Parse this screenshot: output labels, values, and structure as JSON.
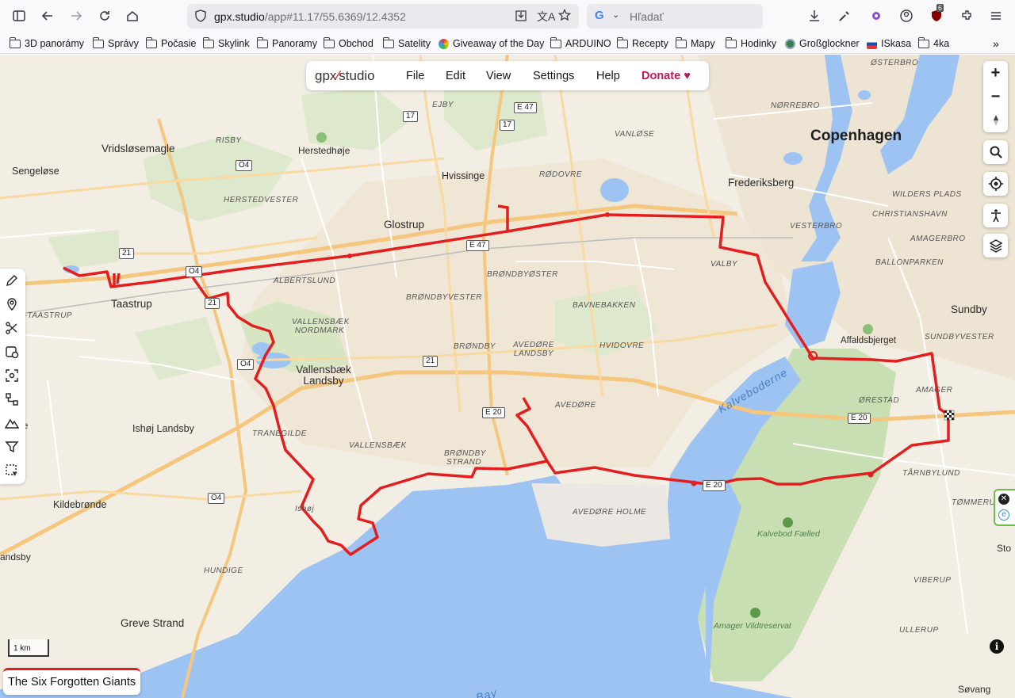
{
  "browser": {
    "url_host": "gpx.studio",
    "url_path": "/app#11.17/55.6369/12.4352",
    "search_placeholder": "Hľadať",
    "ext_badge": "6"
  },
  "bookmarks": [
    {
      "label": "3D panorámy",
      "icon": "folder-icon"
    },
    {
      "label": "Správy",
      "icon": "folder-icon"
    },
    {
      "label": "Počasie",
      "icon": "folder-icon"
    },
    {
      "label": "Skylink",
      "icon": "folder-icon"
    },
    {
      "label": "Panoramy",
      "icon": "folder-icon"
    },
    {
      "label": "Obchod",
      "icon": "folder-icon"
    },
    {
      "label": "Satelity",
      "icon": "folder-icon"
    },
    {
      "label": "Giveaway of the Day",
      "icon": "giveaway-icon"
    },
    {
      "label": "ARDUINO",
      "icon": "folder-icon"
    },
    {
      "label": "Recepty",
      "icon": "folder-icon"
    },
    {
      "label": "Mapy",
      "icon": "folder-icon"
    },
    {
      "label": "Hodinky",
      "icon": "folder-icon"
    },
    {
      "label": "Großglockner",
      "icon": "globe-icon"
    },
    {
      "label": "ISkasa",
      "icon": "flag-icon"
    },
    {
      "label": "4ka",
      "icon": "folder-icon"
    }
  ],
  "app": {
    "logo_left": "gpx",
    "logo_right": "studio",
    "menu": [
      "File",
      "Edit",
      "View",
      "Settings",
      "Help"
    ],
    "donate": "Donate",
    "track_name": "The Six Forgotten Giants",
    "scale": "1 km",
    "zoom_in": "+",
    "zoom_out": "−"
  },
  "map_labels": {
    "big": [
      "Copenhagen"
    ],
    "cities": [
      "Vridsløsemagle",
      "Sengeløse",
      "Herstedhøje",
      "Hvissinge",
      "Glostrup",
      "Frederiksberg",
      "Taastrup",
      "Vallensbæk Landsby",
      "Ishøj Landsby",
      "Kildebrønde",
      "Greve Strand",
      "Sundby",
      "Affaldsbjerget",
      "Ishøj"
    ],
    "districts": [
      "RISBY",
      "EJBY",
      "VANLØSE",
      "RØDOVRE",
      "HERSTEDVESTER",
      "ALBERTSLUND",
      "BRØNDBYØSTER",
      "BRØNDBYVESTER",
      "BAVNEBAKKEN",
      "VALBY",
      "VESTERBRO",
      "NØRREBRO",
      "ØSTERBRO",
      "WILDERS PLADS",
      "CHRISTIANSHAVN",
      "AMAGERBRO",
      "BALLONPARKEN",
      "SUNDBYVESTER",
      "AMAGER",
      "ØRESTAD",
      "TÅRNBYLUND",
      "TØMMERUP",
      "VIBERUP",
      "ULLERUP",
      "HVIDOVRE",
      "AVEDØRE LANDSBY",
      "AVEDØRE",
      "BRØNDBY",
      "VALLENSBÆK NORDMARK",
      "VALLENSBÆK",
      "BRØNDBY STRAND",
      "TRANEGILDE",
      "HUNDIGE",
      "AVEDØRE HOLME",
      "HØJE-TAASTRUP"
    ],
    "water": [
      "Kalveboderne"
    ],
    "parks": [
      "Kalvebod Fælled",
      "Amager Vildtreservat"
    ],
    "shields": [
      "17",
      "17",
      "E 47",
      "E 47",
      "O4",
      "21",
      "O4",
      "21",
      "O4",
      "21",
      "E 20",
      "E 20",
      "E 20",
      "O4"
    ],
    "cut_labels": [
      "slunde",
      "andsby",
      "Sto",
      "Søvang",
      "Bay"
    ]
  }
}
